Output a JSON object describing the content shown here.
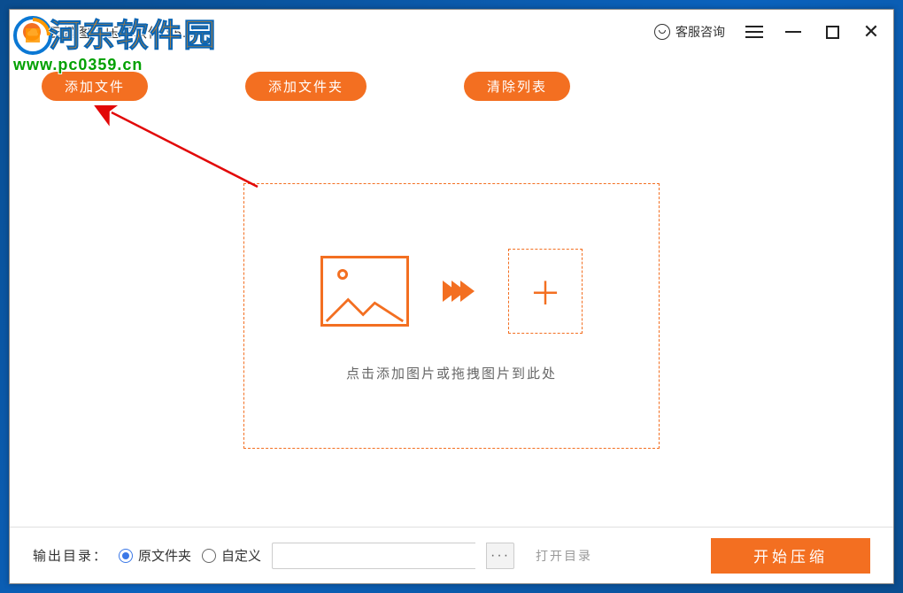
{
  "watermark": {
    "line1": "河东软件园",
    "line2": "www.pc0359.cn"
  },
  "titlebar": {
    "title": "云橙图片压缩软件 v5.6.6",
    "customer_service": "客服咨询"
  },
  "toolbar": {
    "add_file": "添加文件",
    "add_folder": "添加文件夹",
    "clear_list": "清除列表"
  },
  "dropzone": {
    "hint": "点击添加图片或拖拽图片到此处"
  },
  "bottom": {
    "output_label": "输出目录：",
    "opt_original": "原文件夹",
    "opt_custom": "自定义",
    "path_value": "",
    "browse_dots": "···",
    "open_dir": "打开目录",
    "start": "开始压缩"
  }
}
